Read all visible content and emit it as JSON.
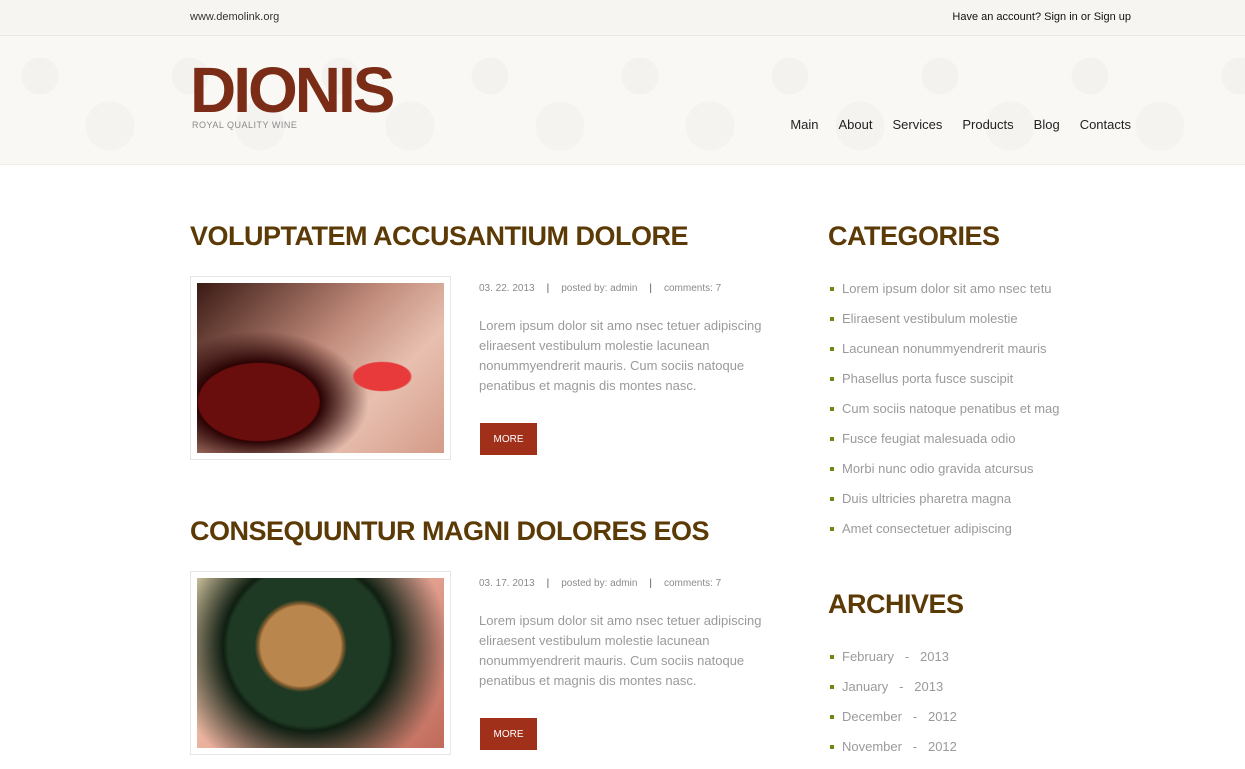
{
  "topbar": {
    "url": "www.demolink.org",
    "account_prefix": "Have an account? ",
    "sign_in": "Sign in",
    "or": " or ",
    "sign_up": "Sign up"
  },
  "logo": {
    "name": "DIONIS",
    "tagline": "ROYAL QUALITY WINE"
  },
  "nav": [
    "Main",
    "About",
    "Services",
    "Products",
    "Blog",
    "Contacts"
  ],
  "posts": [
    {
      "title": "VOLUPTATEM ACCUSANTIUM DOLORE",
      "date": "03. 22. 2013",
      "sep": "|",
      "posted_by": "posted by: admin",
      "comments": "comments: 7",
      "body": "Lorem ipsum dolor sit amo nsec tetuer adipiscing eliraesent vestibulum molestie lacunean nonummyendrerit mauris. Cum sociis natoque penatibus et magnis dis montes nasc.",
      "more": "MORE"
    },
    {
      "title": "CONSEQUUNTUR MAGNI DOLORES EOS",
      "date": "03. 17. 2013",
      "sep": "|",
      "posted_by": "posted by: admin",
      "comments": "comments: 7",
      "body": "Lorem ipsum dolor sit amo nsec tetuer adipiscing eliraesent vestibulum molestie lacunean nonummyendrerit mauris. Cum sociis natoque penatibus et magnis dis montes nasc.",
      "more": "MORE"
    }
  ],
  "categories": {
    "title": "CATEGORIES",
    "items": [
      "Lorem ipsum dolor sit amo nsec tetu",
      "Eliraesent vestibulum molestie",
      "Lacunean nonummyendrerit mauris",
      "Phasellus porta fusce suscipit",
      "Cum sociis natoque penatibus et mag",
      "Fusce feugiat malesuada odio",
      "Morbi nunc odio gravida atcursus",
      "Duis ultricies pharetra magna",
      "Amet consectetuer adipiscing"
    ]
  },
  "archives": {
    "title": "ARCHIVES",
    "items": [
      "February   -   2013",
      "January   -   2013",
      "December   -   2012",
      "November   -   2012"
    ]
  }
}
